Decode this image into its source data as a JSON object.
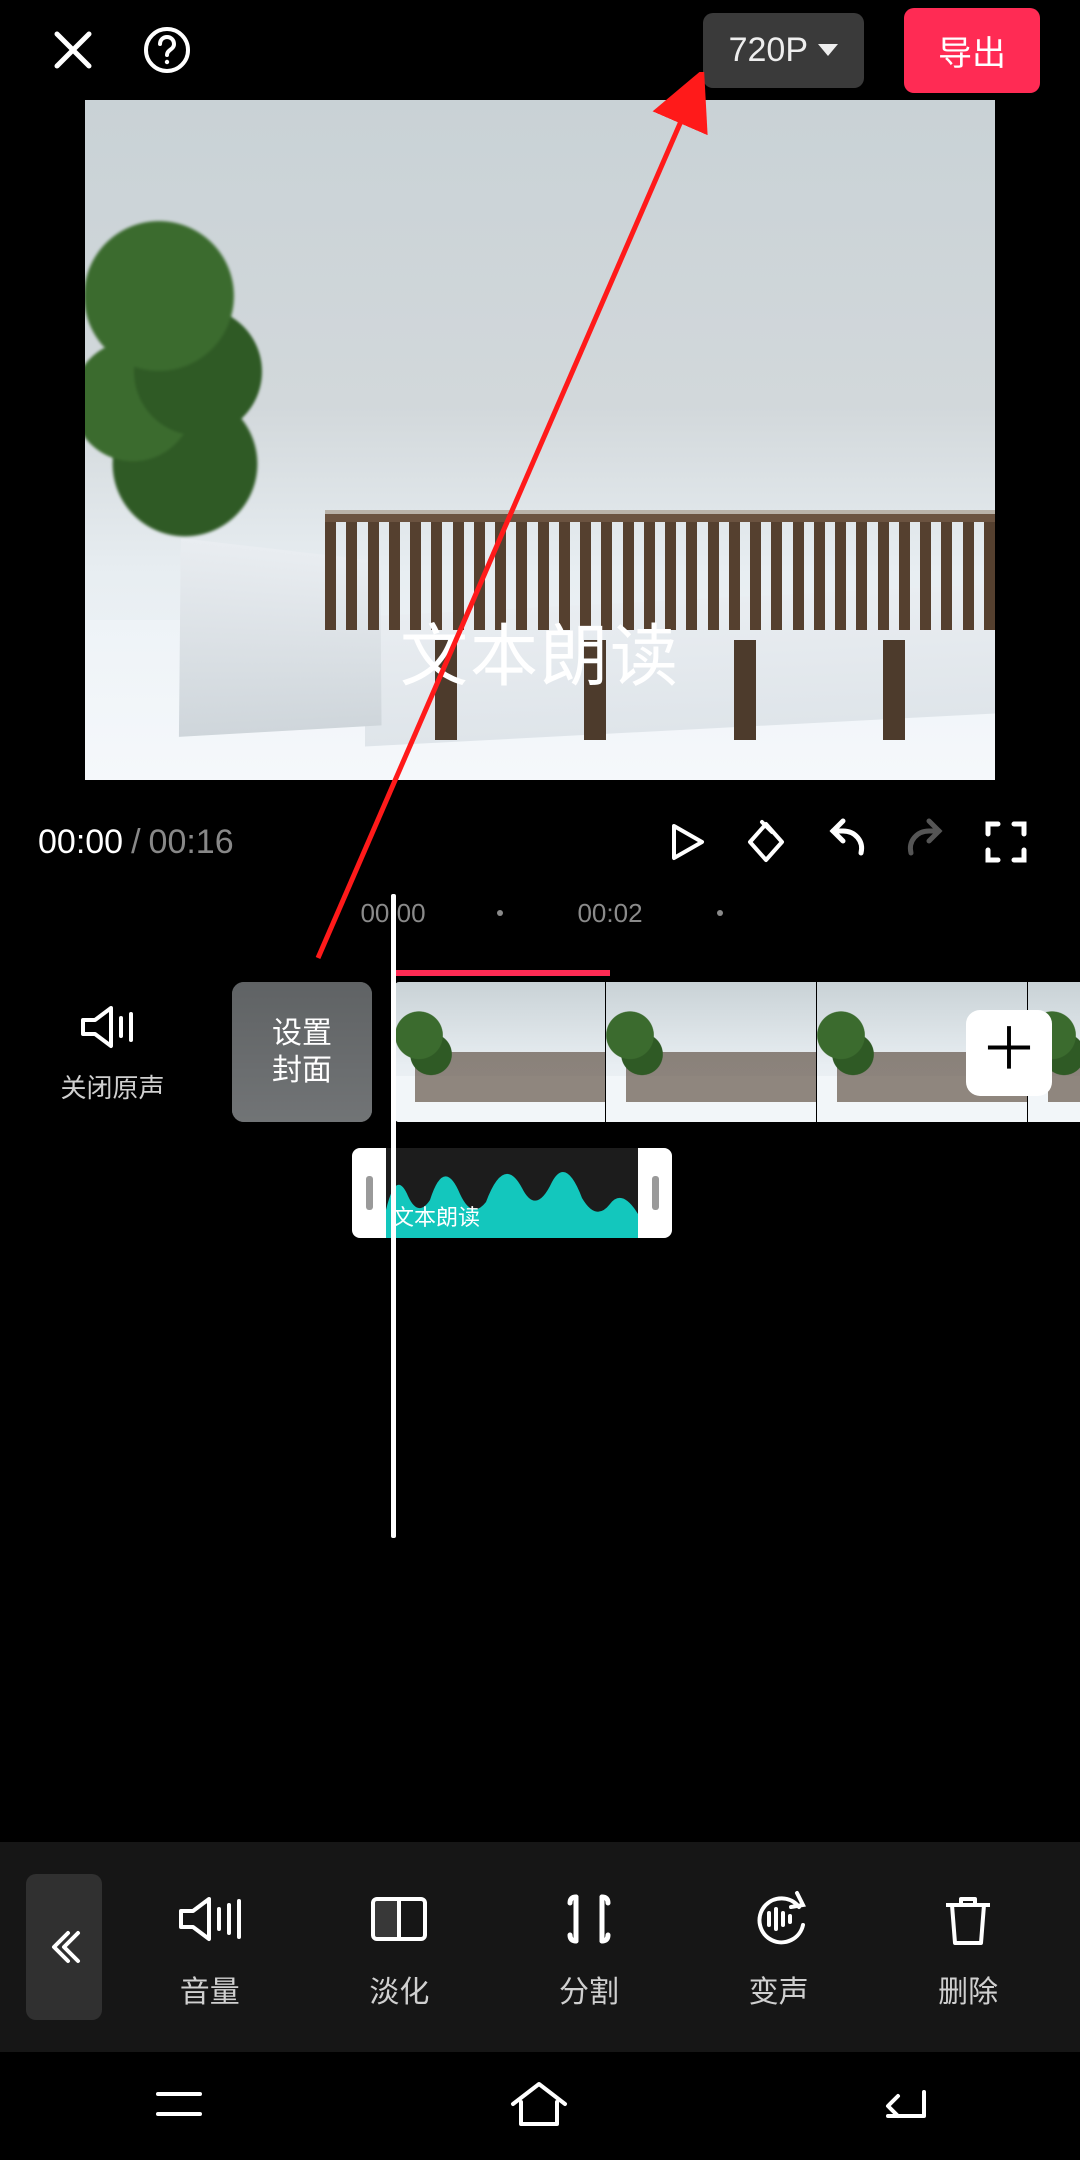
{
  "header": {
    "resolution": "720P",
    "export_label": "导出"
  },
  "preview": {
    "overlay_text": "文本朗读"
  },
  "player": {
    "current_time": "00:00",
    "duration": "00:16"
  },
  "ruler": {
    "marks": [
      "00:00",
      "00:02"
    ]
  },
  "timeline": {
    "mute_label": "关闭原声",
    "cover_label": "设置\n封面",
    "audio_clip_label": "文本朗读"
  },
  "tools": [
    {
      "id": "volume",
      "label": "音量",
      "icon": "speaker"
    },
    {
      "id": "fade",
      "label": "淡化",
      "icon": "fade"
    },
    {
      "id": "split",
      "label": "分割",
      "icon": "split"
    },
    {
      "id": "voice",
      "label": "变声",
      "icon": "voice"
    },
    {
      "id": "delete",
      "label": "删除",
      "icon": "delete"
    }
  ]
}
